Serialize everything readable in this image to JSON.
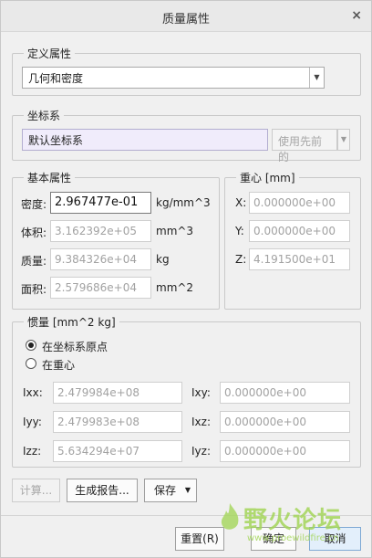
{
  "dialog": {
    "title": "质量属性",
    "close_glyph": "×"
  },
  "define": {
    "group_label": "定义属性",
    "method": "几何和密度",
    "arrow": "▼"
  },
  "coord": {
    "group_label": "坐标系",
    "value": "默认坐标系",
    "use_prev_button": "使用先前的",
    "arrow": "▼"
  },
  "basic": {
    "group_label": "基本属性",
    "density": {
      "label": "密度:",
      "value": "2.967477e-01",
      "unit": "kg/mm^3"
    },
    "volume": {
      "label": "体积:",
      "value": "3.162392e+05",
      "unit": "mm^3"
    },
    "mass": {
      "label": "质量:",
      "value": "9.384326e+04",
      "unit": "kg"
    },
    "area": {
      "label": "面积:",
      "value": "2.579686e+04",
      "unit": "mm^2"
    }
  },
  "centroid": {
    "group_label": "重心 [mm]",
    "x": {
      "label": "X:",
      "value": "0.000000e+00"
    },
    "y": {
      "label": "Y:",
      "value": "0.000000e+00"
    },
    "z": {
      "label": "Z:",
      "value": "4.191500e+01"
    }
  },
  "inertia": {
    "group_label": "惯量 [mm^2 kg]",
    "radio_origin": "在坐标系原点",
    "radio_centroid": "在重心",
    "ixx": {
      "label": "Ixx:",
      "value": "2.479984e+08"
    },
    "iyy": {
      "label": "Iyy:",
      "value": "2.479983e+08"
    },
    "izz": {
      "label": "Izz:",
      "value": "5.634294e+07"
    },
    "ixy": {
      "label": "Ixy:",
      "value": "0.000000e+00"
    },
    "ixz": {
      "label": "Ixz:",
      "value": "0.000000e+00"
    },
    "iyz": {
      "label": "Iyz:",
      "value": "0.000000e+00"
    }
  },
  "actions": {
    "compute": "计算...",
    "report": "生成报告...",
    "save": "保存",
    "save_arrow": "▼"
  },
  "footer": {
    "reset": "重置(R)",
    "ok": "确定",
    "cancel": "取消"
  },
  "watermark": {
    "text": "野火论坛",
    "url": "www.proewildfire.cn"
  },
  "colors": {
    "accent": "#7fa9d4",
    "lavender_field": "#f0ecfb",
    "watermark_green": "#a4d65a"
  }
}
